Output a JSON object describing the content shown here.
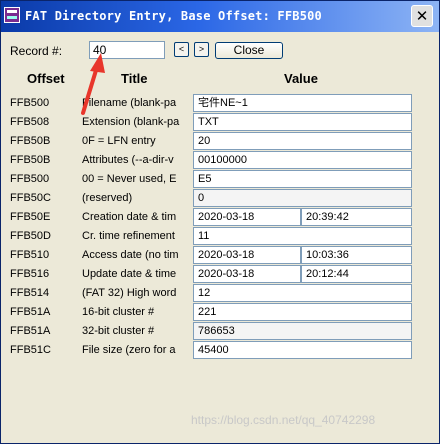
{
  "window": {
    "title": "FAT Directory Entry, Base Offset: FFB500",
    "close_glyph": "✕"
  },
  "controls": {
    "record_label": "Record #:",
    "record_value": "40",
    "prev_label": "<",
    "next_label": ">",
    "close_label": "Close"
  },
  "columns": {
    "offset": "Offset",
    "title": "Title",
    "value": "Value"
  },
  "rows": [
    {
      "offset": "FFB500",
      "title": "Filename (blank-pa",
      "value": "宅件NE~1"
    },
    {
      "offset": "FFB508",
      "title": "Extension (blank-pa",
      "value": "TXT"
    },
    {
      "offset": "FFB50B",
      "title": "0F = LFN entry",
      "value": "20"
    },
    {
      "offset": "FFB50B",
      "title": "Attributes (--a-dir-v",
      "value": "00100000"
    },
    {
      "offset": "FFB500",
      "title": "00 = Never used, E",
      "value": "E5"
    },
    {
      "offset": "FFB50C",
      "title": "(reserved)",
      "value": "0"
    },
    {
      "offset": "FFB50E",
      "title": "Creation date & tim",
      "value": "2020-03-18",
      "value2": "20:39:42"
    },
    {
      "offset": "FFB50D",
      "title": "Cr. time refinement",
      "value": "11"
    },
    {
      "offset": "FFB510",
      "title": "Access date (no tim",
      "value": "2020-03-18",
      "value2": "10:03:36"
    },
    {
      "offset": "FFB516",
      "title": "Update date & time",
      "value": "2020-03-18",
      "value2": "20:12:44"
    },
    {
      "offset": "FFB514",
      "title": "(FAT 32) High word",
      "value": "12"
    },
    {
      "offset": "FFB51A",
      "title": "16-bit cluster #",
      "value": "221"
    },
    {
      "offset": "FFB51A",
      "title": "32-bit cluster #",
      "value": "786653"
    },
    {
      "offset": "FFB51C",
      "title": "File size (zero for a",
      "value": "45400"
    }
  ],
  "watermark": "https://blog.csdn.net/qq_40742298",
  "colors": {
    "annotation_arrow": "#e8362b",
    "titlebar": "#0a3aa8"
  }
}
